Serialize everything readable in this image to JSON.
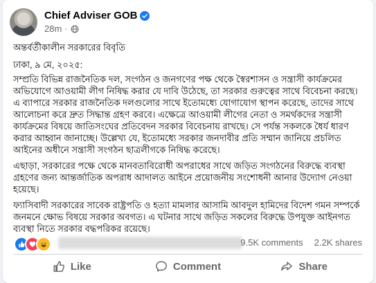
{
  "post": {
    "author": "Chief Adviser GOB",
    "time": "28m",
    "icons": {
      "verified": "verified-badge-icon",
      "audience": "globe-icon"
    },
    "headline": "অন্তর্বর্তীকালীন সরকারের বিবৃতি",
    "dateline": "ঢাকা, ৯ মে, ২০২৫:",
    "paragraphs": [
      "সম্প্রতি বিভিন্ন রাজনৈতিক দল, সংগঠন ও জনগণের পক্ষ থেকে স্বৈরশাসন ও সন্ত্রাসী কার্যক্রমের অভিযোগে আওয়ামী লীগ নিষিদ্ধ করার যে দাবি উঠেছে, তা সরকার গুরুত্বের সাথে বিবেচনা করছে। এ ব্যাপারে সরকার রাজনৈতিক দলগুলোর সাথে ইতোমধ্যে যোগাযোগ স্থাপন করেছে, তাদের সাথে আলোচনা করে দ্রুত সিদ্ধান্ত গ্রহণ করবে। এক্ষেত্রে আওয়ামী লীগের নেতা ও সমর্থকদের সন্ত্রাসী কার্যক্রমের বিষয়ে জাতিসংঘের প্রতিবেদন সরকার বিবেচনায় রাখছে। সে পর্যন্ত সকলকে ধৈর্য ধারণ করার আহ্বান জানাচ্ছে। উল্লেখ্য যে, ইতোমধ্যে সরকার জনদাবীর প্রতি সম্মান জানিয়ে প্রচলিত আইনের অধীনে সন্ত্রাসী সংগঠন ছাত্রলীগকে নিষিদ্ধ করেছে।",
      "এছাড়া, সরকারের পক্ষে থেকে মানবতাবিরোধী অপরাধের সাথে জড়িত সংগঠনের বিরুদ্ধে ব্যবস্থা গ্রহণের জন্য আন্তর্জাতিক অপরাধ আদালত আইনে প্রয়োজনীয় সংশোধনী আনার উদ্যোগ নেওয়া হয়েছে।",
      "ফ্যাসিবাদী সরকারের সাবেক রাষ্ট্রপতি ও হত্যা মামলার আসামি আবদুল হামিদের বিদেশ গমন সম্পর্কে জনমনে ক্ষোভ বিষয়ে সরকার অবগত। এ ঘটনার সাথে জড়িত সকলের বিরুদ্ধে উপযুক্ত আইনগত ব্যবস্থা নিতে সরকার বদ্ধপরিকর রয়েছে।"
    ]
  },
  "stats": {
    "reactions": [
      "like",
      "love",
      "haha"
    ],
    "comments": "9.5K comments",
    "shares": "2.2K shares"
  },
  "actions": {
    "like": "Like",
    "comment": "Comment",
    "share": "Share"
  },
  "colors": {
    "accent": "#1877f2",
    "text": "#050505",
    "muted": "#65676b"
  }
}
